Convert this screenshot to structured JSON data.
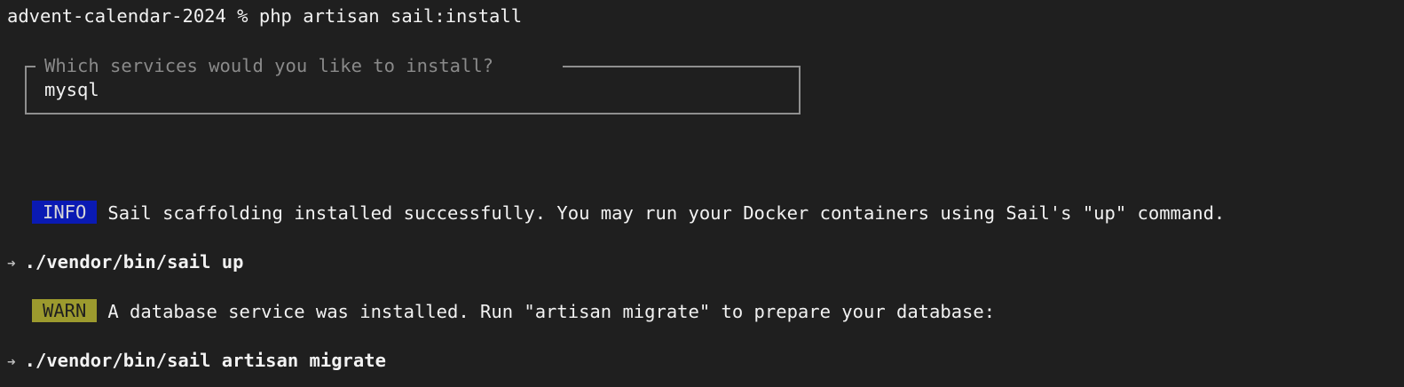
{
  "terminal": {
    "prompt": "advent-calendar-2024 %",
    "command": "php artisan sail:install",
    "question": {
      "label": "Which services would you like to install?",
      "value": "mysql"
    },
    "info": {
      "badge": "INFO",
      "message": "Sail scaffolding installed successfully. You may run your Docker containers using Sail's \"up\" command."
    },
    "command_hint_1": {
      "arrow": "➜",
      "text": "./vendor/bin/sail up"
    },
    "warn": {
      "badge": "WARN",
      "message": "A database service was installed. Run \"artisan migrate\" to prepare your database:"
    },
    "command_hint_2": {
      "arrow": "➜",
      "text": "./vendor/bin/sail artisan migrate"
    }
  },
  "colors": {
    "background": "#1f1f1f",
    "info_badge": "#0a1ab3",
    "warn_badge": "#9c9a2e",
    "box_border": "#8f8f8f"
  }
}
